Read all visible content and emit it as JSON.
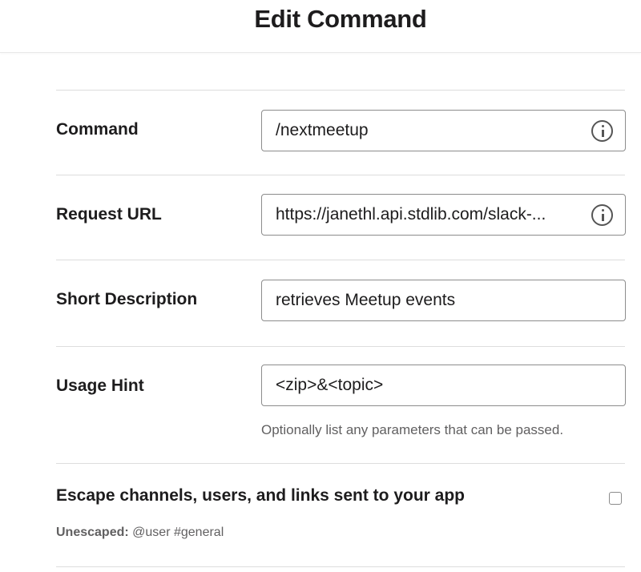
{
  "page": {
    "title": "Edit Command"
  },
  "fields": {
    "command": {
      "label": "Command",
      "value": "/nextmeetup"
    },
    "request_url": {
      "label": "Request URL",
      "value": "https://janethl.api.stdlib.com/slack-..."
    },
    "short_description": {
      "label": "Short Description",
      "value": "retrieves Meetup events"
    },
    "usage_hint": {
      "label": "Usage Hint",
      "value": "<zip>&<topic>",
      "helper": "Optionally list any parameters that can be passed."
    }
  },
  "escape": {
    "label": "Escape channels, users, and links sent to your app",
    "checked": false,
    "unescaped_label": "Unescaped:",
    "unescaped_example": "@user #general"
  },
  "icons": {
    "info": "info-icon"
  },
  "colors": {
    "text": "#1d1c1d",
    "muted": "#616061",
    "border": "#8c8c8c",
    "divider": "#dddddd"
  }
}
